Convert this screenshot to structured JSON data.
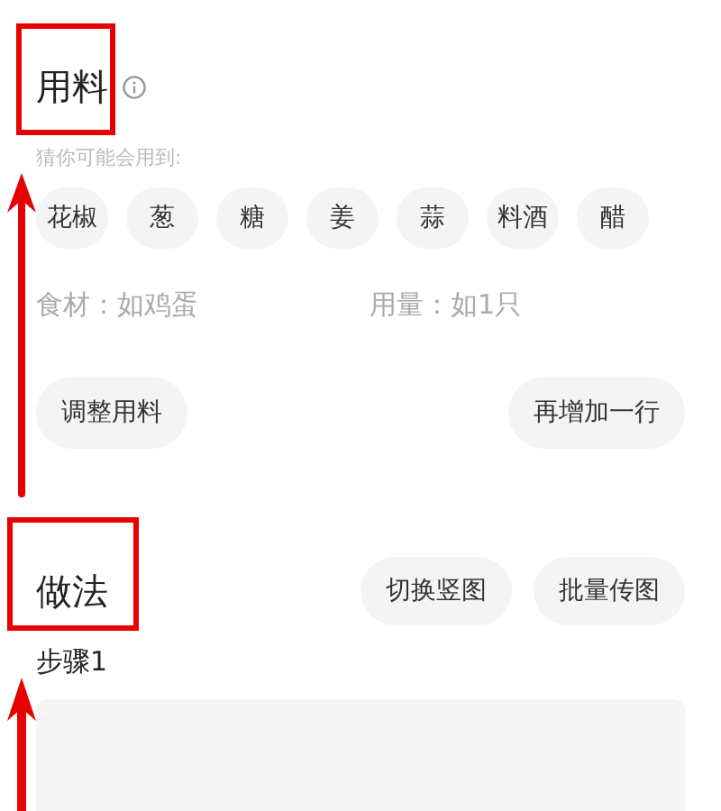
{
  "ingredients": {
    "title": "用料",
    "hint": "猜你可能会用到:",
    "suggestions": [
      "花椒",
      "葱",
      "糖",
      "姜",
      "蒜",
      "料酒",
      "醋"
    ],
    "fields": [
      {
        "placeholder": "食材：如鸡蛋"
      },
      {
        "placeholder": "用量：如1只"
      }
    ],
    "buttons": [
      "调整用料",
      "再增加一行"
    ]
  },
  "method": {
    "title": "做法",
    "buttons": [
      "切换竖图",
      "批量传图"
    ],
    "step_label": "步骤1"
  }
}
